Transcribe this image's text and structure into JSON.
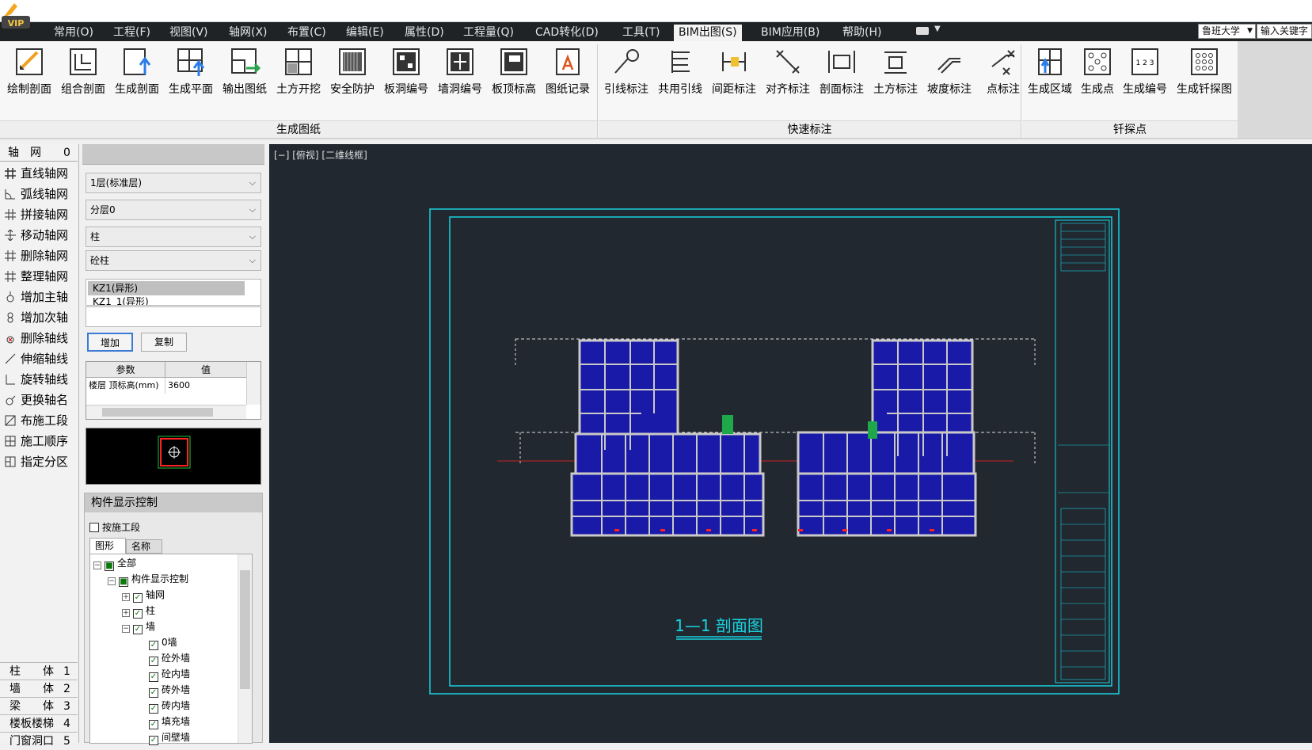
{
  "app": {
    "title": "",
    "logo_text": "VIP"
  },
  "menu": [
    "常用(O)",
    "工程(F)",
    "视图(V)",
    "轴网(X)",
    "布置(C)",
    "编辑(E)",
    "属性(D)",
    "工程量(Q)",
    "CAD转化(D)",
    "工具(T)",
    "BIM出图(S)",
    "BIM应用(B)",
    "帮助(H)"
  ],
  "menu_active": "BIM出图(S)",
  "top_combo": {
    "school": "鲁班大学",
    "search_placeholder": "输入关键字"
  },
  "ribbon": {
    "group1": {
      "label": "生成图纸",
      "buttons": [
        "绘制剖面",
        "组合剖面",
        "生成剖面",
        "生成平面",
        "输出图纸",
        "土方开挖",
        "安全防护",
        "板洞编号",
        "墙洞编号",
        "板顶标高",
        "图纸记录"
      ]
    },
    "group2": {
      "label": "快速标注",
      "buttons": [
        "引线标注",
        "共用引线",
        "间距标注",
        "对齐标注",
        "剖面标注",
        "土方标注",
        "坡度标注",
        "点标注"
      ]
    },
    "group3": {
      "label": "钎探点",
      "buttons": [
        "生成区域",
        "生成点",
        "生成编号",
        "生成钎探图"
      ]
    }
  },
  "left_panel": {
    "header": {
      "name": "轴　网",
      "count": "0"
    },
    "tools": [
      "直线轴网",
      "弧线轴网",
      "拼接轴网",
      "移动轴网",
      "删除轴网",
      "整理轴网",
      "增加主轴",
      "增加次轴",
      "删除轴线",
      "伸缩轴线",
      "旋转轴线",
      "更换轴名",
      "布施工段",
      "施工顺序",
      "指定分区"
    ],
    "categories": [
      {
        "name": "柱　　体",
        "num": "1"
      },
      {
        "name": "墙　　体",
        "num": "2"
      },
      {
        "name": "梁　　体",
        "num": "3"
      },
      {
        "name": "楼板楼梯",
        "num": "4"
      },
      {
        "name": "门窗洞口",
        "num": "5"
      }
    ]
  },
  "props": {
    "floor": "1层(标准层)",
    "sublayer": "分层0",
    "type": "柱",
    "material": "砼柱",
    "list": [
      "KZ1(异形)",
      "KZ1_1(异形)"
    ],
    "add_button": "增加",
    "copy_button": "复制",
    "table": {
      "headers": [
        "参数",
        "值"
      ],
      "rows": [
        [
          "楼层 顶标高(mm)",
          "3600"
        ]
      ]
    }
  },
  "display_control": {
    "title": "构件显示控制",
    "by_section_label": "按施工段",
    "tabs": [
      "图形",
      "名称"
    ],
    "tree": [
      {
        "label": "全部",
        "level": 0
      },
      {
        "label": "构件显示控制",
        "level": 1
      },
      {
        "label": "轴网",
        "level": 2
      },
      {
        "label": "柱",
        "level": 2
      },
      {
        "label": "墙",
        "level": 2
      },
      {
        "label": "0墙",
        "level": 3
      },
      {
        "label": "砼外墙",
        "level": 3
      },
      {
        "label": "砼内墙",
        "level": 3
      },
      {
        "label": "砖外墙",
        "level": 3
      },
      {
        "label": "砖内墙",
        "level": 3
      },
      {
        "label": "填充墙",
        "level": 3
      },
      {
        "label": "间壁墙",
        "level": 3
      }
    ]
  },
  "viewport": {
    "label": "[−] [俯视] [二维线框]",
    "drawing_title": "1—1 剖面图"
  },
  "colors": {
    "canvas_bg": "#212830",
    "frame": "#19d3e0",
    "plan_fill": "#1a1aa8",
    "plan_line": "#c9c97a",
    "red": "#ff2222"
  }
}
